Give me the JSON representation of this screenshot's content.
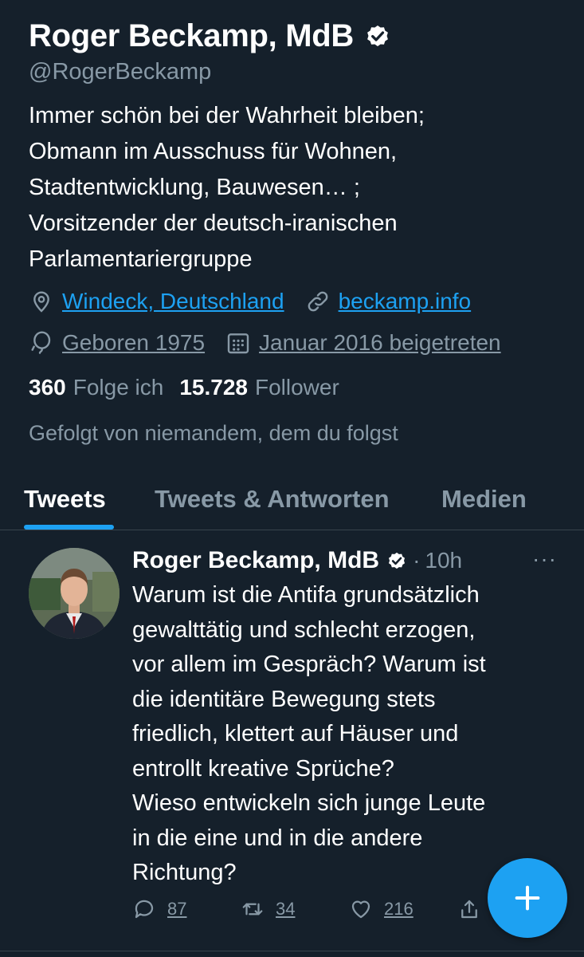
{
  "profile": {
    "name": "Roger Beckamp, MdB",
    "handle": "@RogerBeckamp",
    "bio_lines": [
      "Immer schön bei der Wahrheit bleiben;",
      "Obmann im Ausschuss für Wohnen,",
      "Stadtentwicklung, Bauwesen… ;",
      "Vorsitzender der deutsch-iranischen",
      "Parlamentariergruppe"
    ],
    "location": "Windeck, Deutschland",
    "website": "beckamp.info",
    "born": "Geboren 1975",
    "joined": "Januar 2016 beigetreten",
    "following_count": "360",
    "following_label": "Folge ich",
    "followers_count": "15.728",
    "followers_label": "Follower",
    "followed_by": "Gefolgt von niemandem, dem du folgst"
  },
  "tabs": [
    {
      "label": "Tweets",
      "active": true
    },
    {
      "label": "Tweets & Antworten",
      "active": false
    },
    {
      "label": "Medien",
      "active": false
    }
  ],
  "tweet": {
    "name": "Roger Beckamp, MdB",
    "dot": "·",
    "time": "10h",
    "more": "···",
    "text": "Warum ist die Antifa grundsätzlich\ngewalttätig und  schlecht erzogen,\nvor allem im Gespräch? Warum ist\ndie identitäre Bewegung stets\nfriedlich, klettert auf Häuser und\nentrollt kreative Sprüche?\nWieso entwickeln sich junge Leute\nin die eine und in die andere\nRichtung?",
    "replies": "87",
    "retweets": "34",
    "likes": "216"
  },
  "icons": {
    "verified": "verified-badge-icon",
    "location": "location-pin-icon",
    "link": "link-icon",
    "birthday": "balloon-icon",
    "calendar": "calendar-icon",
    "reply": "reply-icon",
    "retweet": "retweet-icon",
    "like": "heart-icon",
    "share": "share-icon",
    "compose": "plus-icon"
  },
  "colors": {
    "background": "#15202b",
    "accent": "#1da1f2",
    "secondary_text": "#8899a6"
  }
}
